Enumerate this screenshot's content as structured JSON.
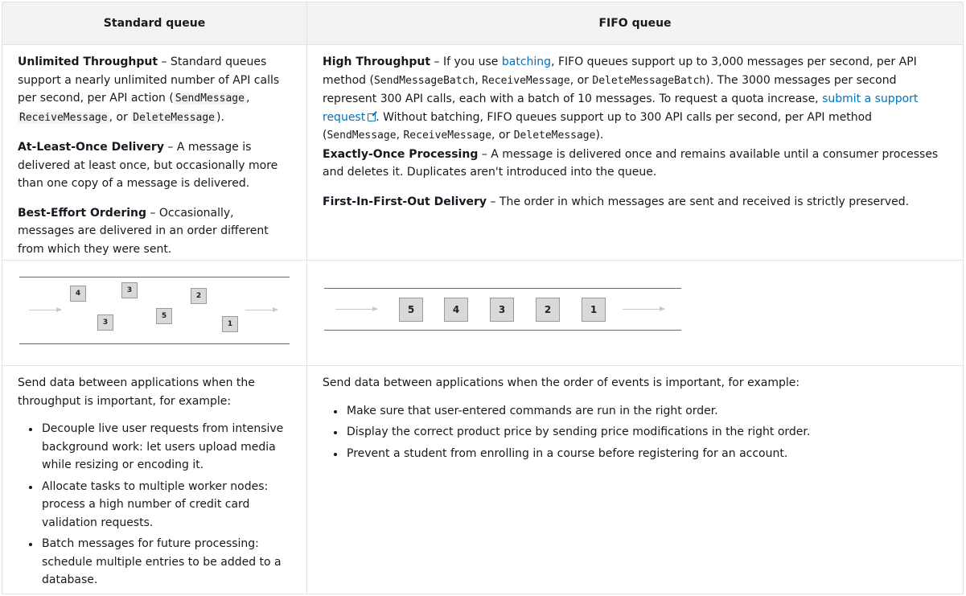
{
  "headers": {
    "standard": "Standard queue",
    "fifo": "FIFO queue"
  },
  "standard": {
    "throughput_title": "Unlimited Throughput",
    "throughput_text_1": " – Standard queues support a nearly unlimited number of API calls per second, per API action (",
    "code_send": "SendMessage",
    "sep_comma": ", ",
    "code_receive": "ReceiveMessage",
    "sep_or": ", or ",
    "code_delete": "DeleteMessage",
    "throughput_text_2": ").",
    "delivery_title": "At-Least-Once Delivery",
    "delivery_text": " – A message is delivered at least once, but occasionally more than one copy of a message is delivered.",
    "ordering_title": "Best-Effort Ordering",
    "ordering_text": " – Occasionally, messages are delivered in an order different from which they were sent.",
    "diagram_boxes": [
      "4",
      "3",
      "3",
      "5",
      "2",
      "1"
    ],
    "use_intro": "Send data between applications when the throughput is important, for example:",
    "use_items": [
      "Decouple live user requests from intensive background work: let users upload media while resizing or encoding it.",
      "Allocate tasks to multiple worker nodes: process a high number of credit card validation requests.",
      "Batch messages for future processing: schedule multiple entries to be added to a database."
    ]
  },
  "fifo": {
    "throughput_title": "High Throughput",
    "t1": " – If you use ",
    "batching_link": "batching",
    "t2": ", FIFO queues support up to 3,000 messages per second, per API method (",
    "code_send_batch": "SendMessageBatch",
    "t3": ", ",
    "code_receive": "ReceiveMessage",
    "t4": ", or ",
    "code_delete_batch": "DeleteMessageBatch",
    "t5": "). The 3000 messages per second represent 300 API calls, each with a batch of 10 messages. To request a quota increase, ",
    "support_link": "submit a support request",
    "t6": ". Without batching, FIFO queues support up to 300 API calls per second, per API method (",
    "code_send": "SendMessage",
    "t7": ", ",
    "code_receive_2": "ReceiveMessage",
    "t8": ", or ",
    "code_delete": "DeleteMessage",
    "t9": ").",
    "processing_title": "Exactly-Once Processing",
    "processing_text": " – A message is delivered once and remains available until a consumer processes and deletes it. Duplicates aren't introduced into the queue.",
    "fifo_title": "First-In-First-Out Delivery",
    "fifo_text": " – The order in which messages are sent and received is strictly preserved.",
    "diagram_boxes": [
      "5",
      "4",
      "3",
      "2",
      "1"
    ],
    "use_intro": "Send data between applications when the order of events is important, for example:",
    "use_items": [
      "Make sure that user-entered commands are run in the right order.",
      "Display the correct product price by sending price modifications in the right order.",
      "Prevent a student from enrolling in a course before registering for an account."
    ]
  },
  "colors": {
    "link": "#0073bb",
    "header_bg": "#f3f3f3",
    "border": "#e3e3e3",
    "box_fill": "#d9d9d9"
  }
}
